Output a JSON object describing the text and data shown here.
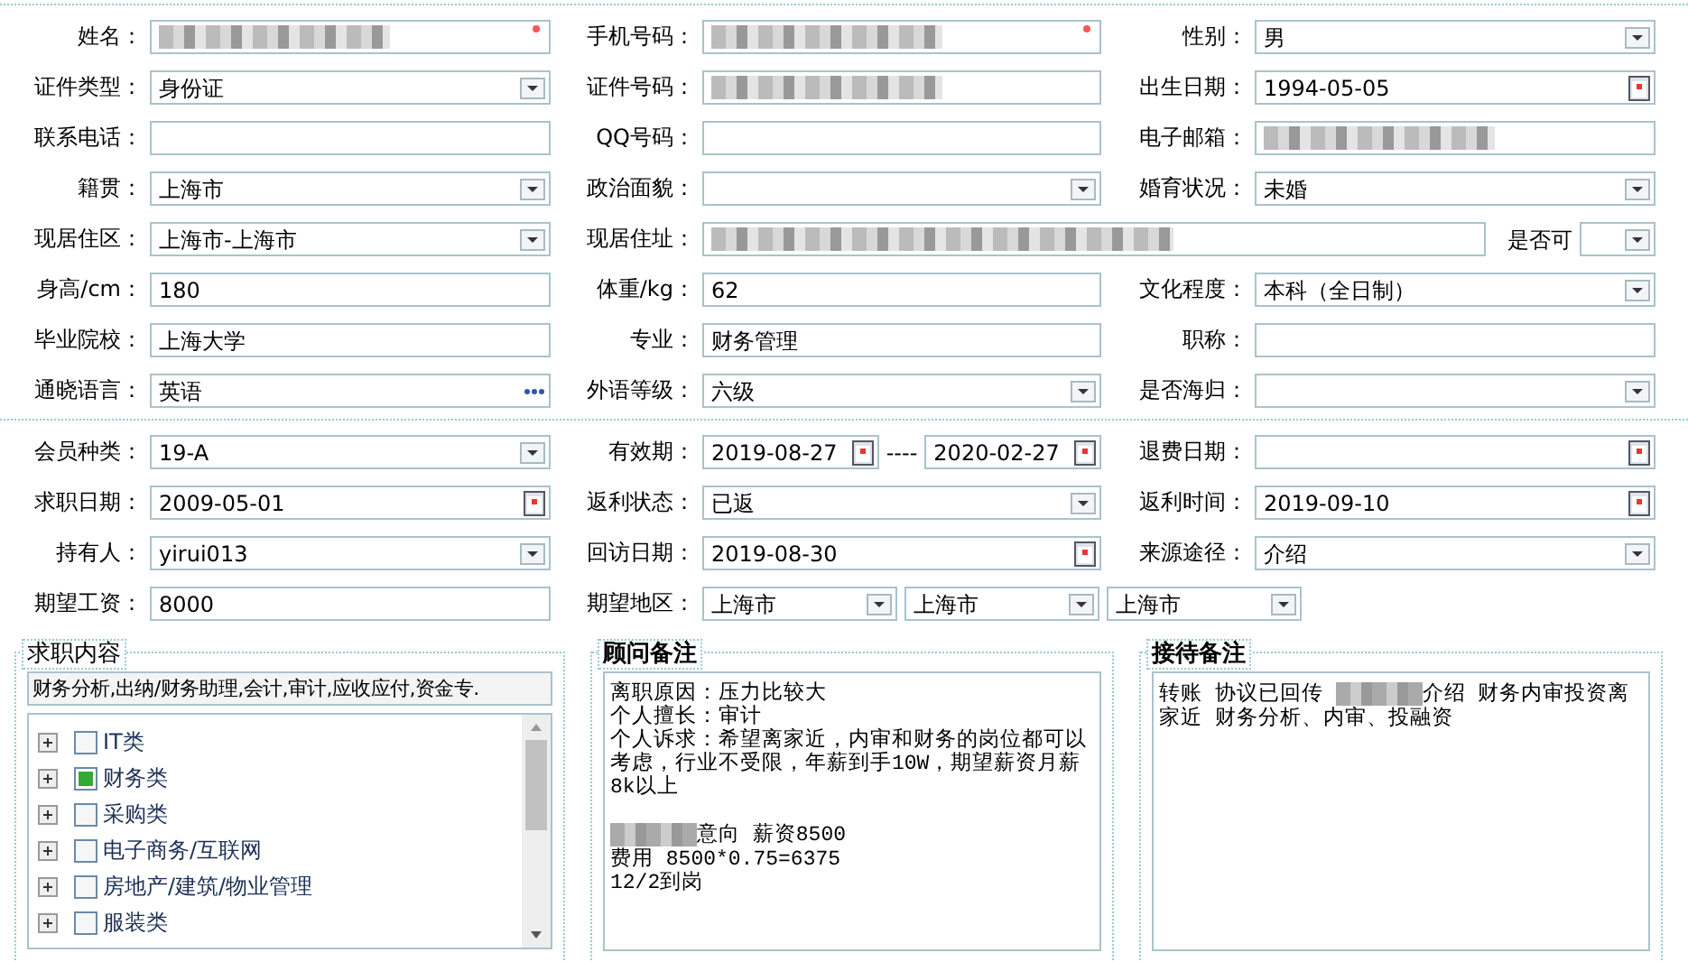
{
  "sections": [
    {
      "rows": [
        [
          {
            "label": "姓名：",
            "fields": [
              {
                "kind": "redacted",
                "required": true
              }
            ]
          },
          {
            "label": "手机号码：",
            "fields": [
              {
                "kind": "redacted",
                "required": true
              }
            ]
          },
          {
            "label": "性别：",
            "fields": [
              {
                "kind": "select",
                "value": "男"
              }
            ]
          }
        ],
        [
          {
            "label": "证件类型：",
            "fields": [
              {
                "kind": "select",
                "value": "身份证"
              }
            ]
          },
          {
            "label": "证件号码：",
            "fields": [
              {
                "kind": "redacted"
              }
            ]
          },
          {
            "label": "出生日期：",
            "fields": [
              {
                "kind": "date",
                "value": "1994-05-05"
              }
            ]
          }
        ],
        [
          {
            "label": "联系电话：",
            "fields": [
              {
                "kind": "text"
              }
            ]
          },
          {
            "label": "QQ号码：",
            "fields": [
              {
                "kind": "text"
              }
            ]
          },
          {
            "label": "电子邮箱：",
            "fields": [
              {
                "kind": "redacted"
              }
            ]
          }
        ],
        [
          {
            "label": "籍贯：",
            "fields": [
              {
                "kind": "select",
                "value": "上海市"
              }
            ]
          },
          {
            "label": "政治面貌：",
            "fields": [
              {
                "kind": "select"
              }
            ]
          },
          {
            "label": "婚育状况：",
            "fields": [
              {
                "kind": "select",
                "value": "未婚"
              }
            ]
          }
        ],
        [
          {
            "label": "现居住区：",
            "fields": [
              {
                "kind": "select",
                "value": "上海市-上海市"
              }
            ]
          },
          {
            "label": "现居住址：",
            "fields": [
              {
                "kind": "redacted"
              },
              {
                "kind": "caption",
                "text": "是否可"
              },
              {
                "kind": "select"
              }
            ]
          }
        ],
        [
          {
            "label": "身高/cm：",
            "fields": [
              {
                "kind": "text",
                "value": "180"
              }
            ]
          },
          {
            "label": "体重/kg：",
            "fields": [
              {
                "kind": "text",
                "value": "62"
              }
            ]
          },
          {
            "label": "文化程度：",
            "fields": [
              {
                "kind": "select",
                "value": "本科（全日制）"
              }
            ]
          }
        ],
        [
          {
            "label": "毕业院校：",
            "fields": [
              {
                "kind": "text",
                "value": "上海大学"
              }
            ]
          },
          {
            "label": "专业：",
            "fields": [
              {
                "kind": "text",
                "value": "财务管理"
              }
            ]
          },
          {
            "label": "职称：",
            "fields": [
              {
                "kind": "text"
              }
            ]
          }
        ],
        [
          {
            "label": "通晓语言：",
            "fields": [
              {
                "kind": "lookup",
                "value": "英语"
              }
            ]
          },
          {
            "label": "外语等级：",
            "fields": [
              {
                "kind": "select",
                "value": "六级"
              }
            ]
          },
          {
            "label": "是否海归：",
            "fields": [
              {
                "kind": "select"
              }
            ]
          }
        ]
      ]
    },
    {
      "rows": [
        [
          {
            "label": "会员种类：",
            "fields": [
              {
                "kind": "select",
                "value": "19-A"
              }
            ]
          },
          {
            "label": "有效期：",
            "fields": [
              {
                "kind": "date",
                "value": "2019-08-27"
              },
              {
                "kind": "caption",
                "text": "----"
              },
              {
                "kind": "date",
                "value": "2020-02-27"
              }
            ]
          },
          {
            "label": "退费日期：",
            "fields": [
              {
                "kind": "date"
              }
            ]
          }
        ],
        [
          {
            "label": "求职日期：",
            "fields": [
              {
                "kind": "date",
                "value": "2009-05-01"
              }
            ]
          },
          {
            "label": "返利状态：",
            "fields": [
              {
                "kind": "select",
                "value": "已返"
              }
            ]
          },
          {
            "label": "返利时间：",
            "fields": [
              {
                "kind": "date",
                "value": "2019-09-10"
              }
            ]
          }
        ],
        [
          {
            "label": "持有人：",
            "fields": [
              {
                "kind": "select",
                "value": "yirui013"
              }
            ]
          },
          {
            "label": "回访日期：",
            "fields": [
              {
                "kind": "date",
                "value": "2019-08-30"
              }
            ]
          },
          {
            "label": "来源途径：",
            "fields": [
              {
                "kind": "select",
                "value": "介绍"
              }
            ]
          }
        ],
        [
          {
            "label": "期望工资：",
            "fields": [
              {
                "kind": "text",
                "value": "8000"
              }
            ]
          },
          {
            "label": "期望地区：",
            "fields": [
              {
                "kind": "select",
                "value": "上海市"
              },
              {
                "kind": "select",
                "value": "上海市"
              },
              {
                "kind": "select",
                "value": "上海市"
              }
            ]
          }
        ]
      ]
    }
  ],
  "panels": [
    {
      "kind": "tree",
      "title": "求职内容",
      "summary": "财务分析,出纳/财务助理,会计,审计,应收应付,资金专.",
      "items": [
        {
          "label": "IT类",
          "checked": false
        },
        {
          "label": "财务类",
          "checked": true
        },
        {
          "label": "采购类",
          "checked": false
        },
        {
          "label": "电子商务/互联网",
          "checked": false
        },
        {
          "label": "房地产/建筑/物业管理",
          "checked": false
        },
        {
          "label": "服装类",
          "checked": false
        }
      ]
    },
    {
      "kind": "notes",
      "title": "顾问备注",
      "paragraphs": [
        {
          "segments": [
            {
              "text": "离职原因：压力比较大"
            }
          ]
        },
        {
          "segments": [
            {
              "text": "个人擅长：审计"
            }
          ]
        },
        {
          "segments": [
            {
              "text": "个人诉求：希望离家近，内审和财务的岗位都可以考虑，行业不受限，年薪到手10W，期望薪资月薪8k以上"
            }
          ]
        },
        {
          "spaced": true,
          "segments": [
            {
              "kind": "redacted"
            },
            {
              "text": "意向 薪资8500"
            }
          ]
        },
        {
          "segments": [
            {
              "text": "费用 8500*0.75=6375"
            }
          ]
        },
        {
          "segments": [
            {
              "text": "12/2到岗"
            }
          ]
        }
      ]
    },
    {
      "kind": "notes",
      "title": "接待备注",
      "paragraphs": [
        {
          "segments": [
            {
              "text": "转账 协议已回传 "
            },
            {
              "kind": "redacted"
            },
            {
              "text": "介绍 财务内审投资离家近 财务分析、内审、投融资"
            }
          ]
        }
      ]
    }
  ]
}
